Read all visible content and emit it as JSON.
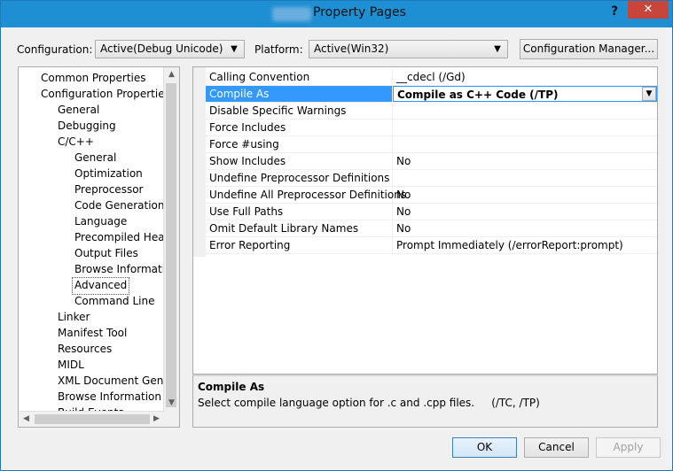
{
  "window": {
    "title": "Property Pages",
    "help_glyph": "?",
    "close_glyph": "✕"
  },
  "toolbar": {
    "configuration_label": "Configuration:",
    "configuration_value": "Active(Debug Unicode)",
    "platform_label": "Platform:",
    "platform_value": "Active(Win32)",
    "config_manager_label": "Configuration Manager..."
  },
  "tree": {
    "items": [
      {
        "label": "Common Properties"
      },
      {
        "label": "Configuration Properties"
      },
      {
        "label": "General"
      },
      {
        "label": "Debugging"
      },
      {
        "label": "C/C++"
      },
      {
        "label": "General"
      },
      {
        "label": "Optimization"
      },
      {
        "label": "Preprocessor"
      },
      {
        "label": "Code Generation"
      },
      {
        "label": "Language"
      },
      {
        "label": "Precompiled Heade"
      },
      {
        "label": "Output Files"
      },
      {
        "label": "Browse Information"
      },
      {
        "label": "Advanced"
      },
      {
        "label": "Command Line"
      },
      {
        "label": "Linker"
      },
      {
        "label": "Manifest Tool"
      },
      {
        "label": "Resources"
      },
      {
        "label": "MIDL"
      },
      {
        "label": "XML Document Genera"
      },
      {
        "label": "Browse Information"
      },
      {
        "label": "Build Events"
      }
    ]
  },
  "properties": {
    "rows": [
      {
        "name": "Calling Convention",
        "value": "__cdecl (/Gd)"
      },
      {
        "name": "Compile As",
        "value": "Compile as C++ Code (/TP)"
      },
      {
        "name": "Disable Specific Warnings",
        "value": ""
      },
      {
        "name": "Force Includes",
        "value": ""
      },
      {
        "name": "Force #using",
        "value": ""
      },
      {
        "name": "Show Includes",
        "value": "No"
      },
      {
        "name": "Undefine Preprocessor Definitions",
        "value": ""
      },
      {
        "name": "Undefine All Preprocessor Definitions",
        "value": "No"
      },
      {
        "name": "Use Full Paths",
        "value": "No"
      },
      {
        "name": "Omit Default Library Names",
        "value": "No"
      },
      {
        "name": "Error Reporting",
        "value": "Prompt Immediately (/errorReport:prompt)"
      }
    ]
  },
  "description": {
    "title": "Compile As",
    "text": "Select compile language option for .c and .cpp files.     (/TC, /TP)"
  },
  "buttons": {
    "ok": "OK",
    "cancel": "Cancel",
    "apply": "Apply"
  }
}
